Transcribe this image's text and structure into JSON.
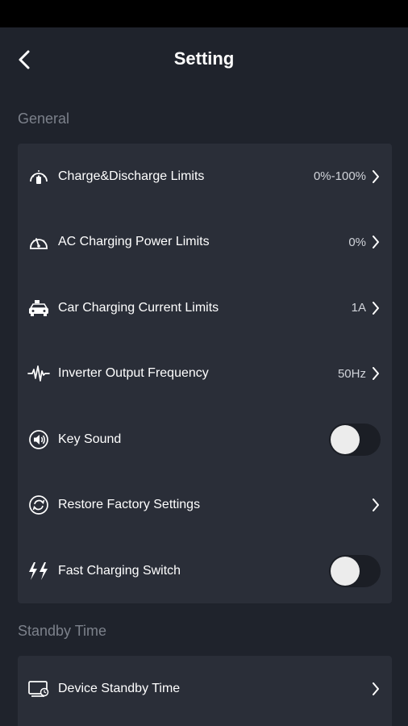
{
  "header": {
    "title": "Setting"
  },
  "sections": {
    "general": {
      "label": "General",
      "items": [
        {
          "label": "Charge&Discharge Limits",
          "value": "0%-100%",
          "icon": "battery-gauge-icon",
          "control": "chevron"
        },
        {
          "label": "AC Charging Power Limits",
          "value": "0%",
          "icon": "speedometer-icon",
          "control": "chevron"
        },
        {
          "label": "Car Charging Current Limits",
          "value": "1A",
          "icon": "car-charging-icon",
          "control": "chevron"
        },
        {
          "label": "Inverter Output Frequency",
          "value": "50Hz",
          "icon": "waveform-icon",
          "control": "chevron"
        },
        {
          "label": "Key Sound",
          "icon": "speaker-icon",
          "control": "toggle",
          "on": false
        },
        {
          "label": "Restore Factory Settings",
          "value": "",
          "icon": "restore-icon",
          "control": "chevron"
        },
        {
          "label": "Fast Charging Switch",
          "icon": "lightning-icon",
          "control": "toggle",
          "on": false
        }
      ]
    },
    "standby": {
      "label": "Standby Time",
      "items": [
        {
          "label": "Device Standby Time",
          "value": "",
          "icon": "monitor-timer-icon",
          "control": "chevron"
        }
      ]
    }
  },
  "colors": {
    "background": "#1f232c",
    "card": "#2a2e38",
    "section_label": "#7c818b",
    "toggle_track": "#1b1e25",
    "toggle_knob": "#ececec"
  }
}
